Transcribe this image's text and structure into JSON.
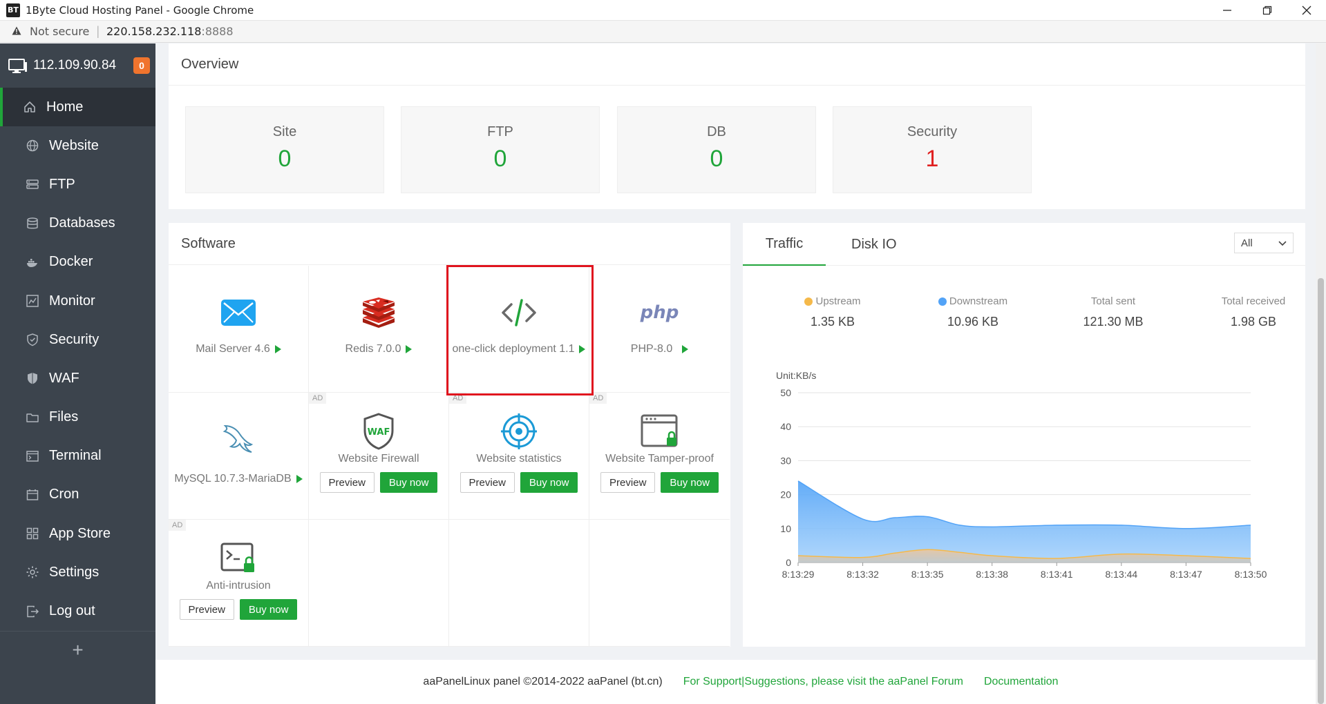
{
  "browser": {
    "favicon": "BT",
    "title": "1Byte Cloud Hosting Panel - Google Chrome",
    "security": "Not secure",
    "url_host": "220.158.232.118",
    "url_port": ":8888"
  },
  "sidebar": {
    "host_ip": "112.109.90.84",
    "badge": "0",
    "items": [
      {
        "label": "Home",
        "icon": "home-icon"
      },
      {
        "label": "Website",
        "icon": "globe-icon"
      },
      {
        "label": "FTP",
        "icon": "ftp-icon"
      },
      {
        "label": "Databases",
        "icon": "database-icon"
      },
      {
        "label": "Docker",
        "icon": "docker-icon"
      },
      {
        "label": "Monitor",
        "icon": "monitor-chart-icon"
      },
      {
        "label": "Security",
        "icon": "shield-icon"
      },
      {
        "label": "WAF",
        "icon": "waf-shield-icon"
      },
      {
        "label": "Files",
        "icon": "folder-icon"
      },
      {
        "label": "Terminal",
        "icon": "terminal-icon"
      },
      {
        "label": "Cron",
        "icon": "calendar-icon"
      },
      {
        "label": "App Store",
        "icon": "grid-icon"
      },
      {
        "label": "Settings",
        "icon": "gear-icon"
      },
      {
        "label": "Log out",
        "icon": "logout-icon"
      }
    ],
    "add": "+"
  },
  "overview": {
    "title": "Overview",
    "stats": [
      {
        "label": "Site",
        "value": "0"
      },
      {
        "label": "FTP",
        "value": "0"
      },
      {
        "label": "DB",
        "value": "0"
      },
      {
        "label": "Security",
        "value": "1"
      }
    ]
  },
  "software": {
    "title": "Software",
    "ad": "AD",
    "preview": "Preview",
    "buy": "Buy now",
    "apps": [
      {
        "name": "Mail Server 4.6",
        "icon": "mail-icon"
      },
      {
        "name": "Redis 7.0.0",
        "icon": "redis-icon"
      },
      {
        "name": "one-click deployment 1.1",
        "icon": "code-icon"
      },
      {
        "name": "PHP-8.0",
        "icon": "php-icon"
      },
      {
        "name": "MySQL 10.7.3-MariaDB",
        "icon": "mysql-dolphin-icon"
      }
    ],
    "ads": [
      {
        "name": "Website Firewall",
        "icon": "waf-icon"
      },
      {
        "name": "Website statistics",
        "icon": "target-icon"
      },
      {
        "name": "Website Tamper-proof",
        "icon": "browser-lock-icon"
      },
      {
        "name": "Anti-intrusion",
        "icon": "terminal-lock-icon"
      }
    ],
    "php_logo": "php",
    "waf_logo": "WAF"
  },
  "traffic": {
    "tabs": [
      "Traffic",
      "Disk IO"
    ],
    "select": "All",
    "metrics": [
      {
        "label": "Upstream",
        "value": "1.35 KB",
        "color": "#f5b94a"
      },
      {
        "label": "Downstream",
        "value": "10.96 KB",
        "color": "#52a3f7"
      },
      {
        "label": "Total sent",
        "value": "121.30 MB"
      },
      {
        "label": "Total received",
        "value": "1.98 GB"
      }
    ]
  },
  "chart_data": {
    "type": "area",
    "ylabel": "Unit:KB/s",
    "ylim": [
      0,
      50
    ],
    "yticks": [
      0,
      10,
      20,
      30,
      40,
      50
    ],
    "x": [
      "8:13:29",
      "8:13:32",
      "8:13:35",
      "8:13:38",
      "8:13:41",
      "8:13:44",
      "8:13:47",
      "8:13:50"
    ],
    "series": [
      {
        "name": "Downstream",
        "color": "#52a3f7",
        "x": [
          0,
          1,
          1.5,
          2,
          2.5,
          3,
          4,
          5,
          6,
          7
        ],
        "values": [
          24,
          12.8,
          13.2,
          13.5,
          11,
          10.5,
          11,
          11,
          10,
          11
        ]
      },
      {
        "name": "Upstream",
        "color": "#f5b94a",
        "x": [
          0,
          1,
          1.5,
          2,
          2.5,
          3,
          4,
          5,
          6,
          7
        ],
        "values": [
          2,
          1.5,
          2.8,
          3.8,
          3,
          2,
          1.2,
          2.5,
          2,
          1.2
        ]
      }
    ],
    "grid": true
  },
  "footer": {
    "copyright": "aaPanelLinux panel ©2014-2022 aaPanel (bt.cn)",
    "support": "For Support|Suggestions, please visit the aaPanel Forum",
    "docs": "Documentation"
  }
}
